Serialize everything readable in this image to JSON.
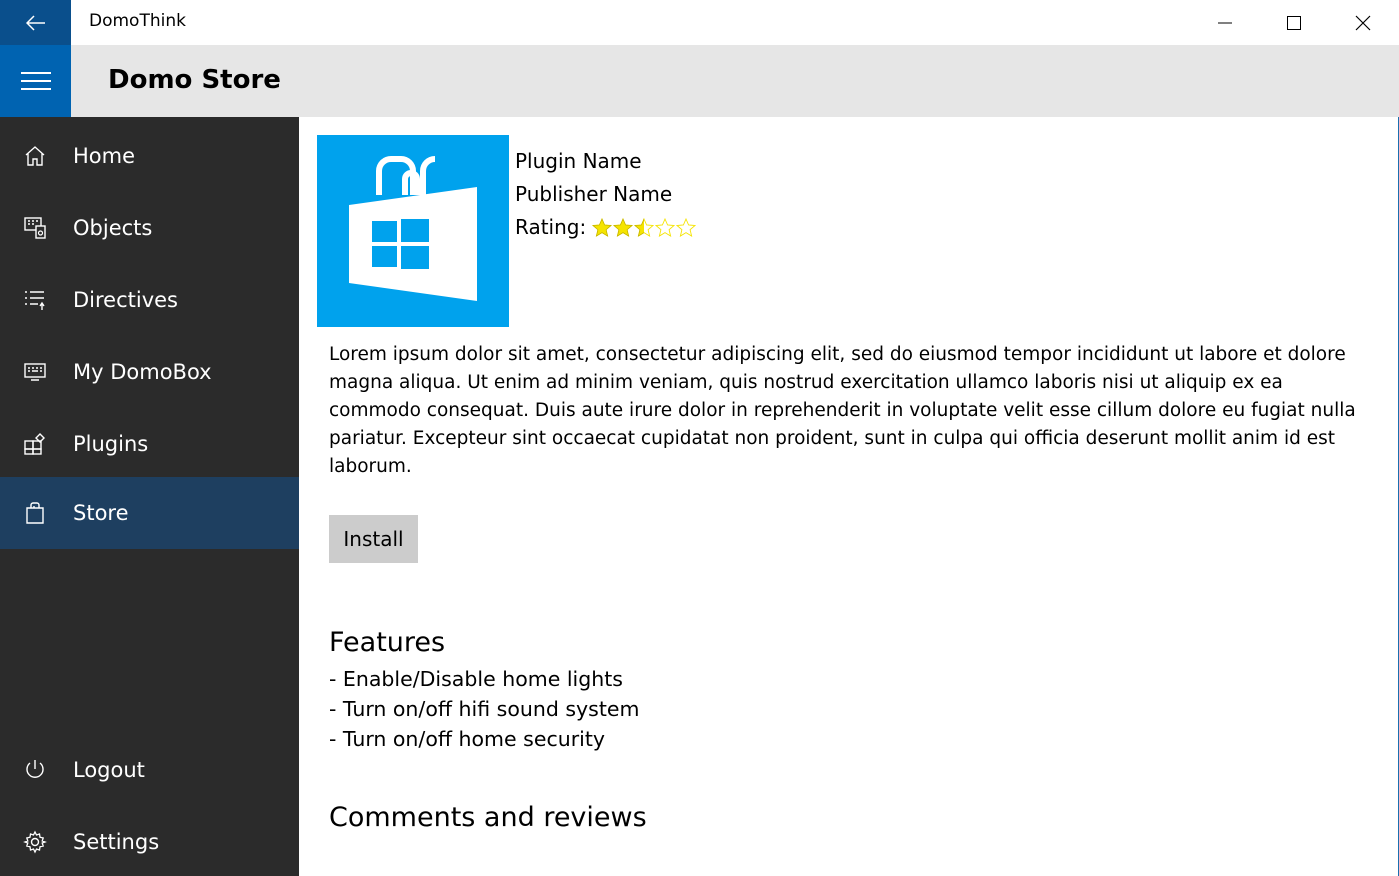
{
  "window": {
    "title": "DomoThink"
  },
  "header": {
    "title": "Domo Store"
  },
  "sidebar": {
    "items": [
      {
        "label": "Home",
        "icon": "home-icon"
      },
      {
        "label": "Objects",
        "icon": "objects-icon"
      },
      {
        "label": "Directives",
        "icon": "directives-icon"
      },
      {
        "label": "My DomoBox",
        "icon": "domobox-icon"
      },
      {
        "label": "Plugins",
        "icon": "plugins-icon"
      },
      {
        "label": "Store",
        "icon": "store-icon",
        "active": true
      }
    ],
    "bottom_items": [
      {
        "label": "Logout",
        "icon": "power-icon"
      },
      {
        "label": "Settings",
        "icon": "gear-icon"
      }
    ]
  },
  "plugin": {
    "name": "Plugin Name",
    "publisher": "Publisher Name",
    "rating_label": "Rating:",
    "rating": 2.5,
    "rating_max": 5,
    "logo_icon": "store-bag-icon",
    "description": "Lorem ipsum dolor sit amet, consectetur adipiscing elit, sed do eiusmod tempor incididunt ut labore et dolore magna aliqua. Ut enim ad minim veniam, quis nostrud exercitation ullamco laboris nisi ut aliquip ex ea commodo consequat. Duis aute irure dolor in reprehenderit in voluptate velit esse cillum dolore eu fugiat nulla pariatur. Excepteur sint occaecat cupidatat non proident, sunt in culpa qui officia deserunt mollit anim id est laborum.",
    "install_label": "Install"
  },
  "features": {
    "title": "Features",
    "items": [
      "- Enable/Disable home lights",
      "- Turn on/off hifi sound system",
      "- Turn on/off home security"
    ]
  },
  "comments": {
    "title": "Comments and reviews"
  },
  "colors": {
    "accent": "#0063b1",
    "back_button": "#0a4f8c",
    "sidebar_bg": "#2b2b2b",
    "sidebar_active": "#1e3f60",
    "logo_bg": "#00a2ed",
    "star_fill": "#f5e400"
  }
}
